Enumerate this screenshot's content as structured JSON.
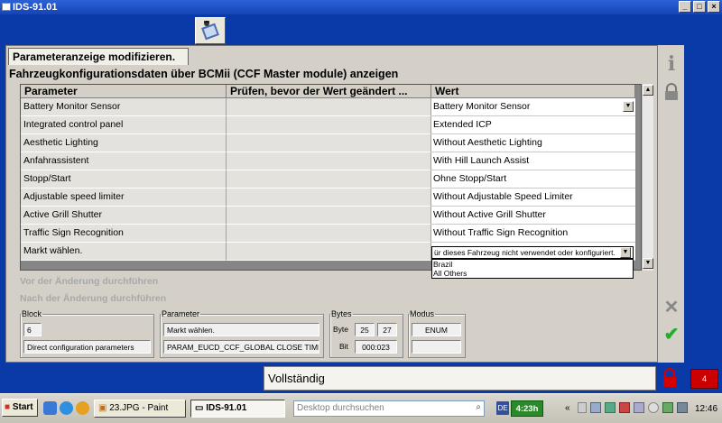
{
  "window": {
    "title": "IDS-91.01",
    "min_label": "_",
    "max_label": "□",
    "close_label": "×"
  },
  "tab_label": "Parameteranzeige modifizieren.",
  "subtitle": "Fahrzeugkonfigurationsdaten über BCMii (CCF Master module) anzeigen",
  "table": {
    "headers": [
      "Parameter",
      "Prüfen, bevor der Wert geändert ...",
      "Wert"
    ],
    "rows": [
      {
        "param": "Battery Monitor Sensor",
        "check": "",
        "value": "Battery Monitor Sensor"
      },
      {
        "param": "Integrated control panel",
        "check": "",
        "value": "Extended ICP"
      },
      {
        "param": "Aesthetic Lighting",
        "check": "",
        "value": "Without Aesthetic Lighting"
      },
      {
        "param": "Anfahrassistent",
        "check": "",
        "value": "With Hill Launch Assist"
      },
      {
        "param": "Stopp/Start",
        "check": "",
        "value": "Ohne Stopp/Start"
      },
      {
        "param": "Adjustable speed limiter",
        "check": "",
        "value": "Without Adjustable Speed Limiter"
      },
      {
        "param": "Active Grill Shutter",
        "check": "",
        "value": "Without Active Grill Shutter"
      },
      {
        "param": "Traffic Sign Recognition",
        "check": "",
        "value": "Without Traffic Sign Recognition"
      },
      {
        "param": "Markt wählen.",
        "check": "",
        "value": ""
      }
    ],
    "dropdown_selected": "ür dieses Fahrzeug nicht verwendet oder konfiguriert.",
    "dropdown_options": [
      "Brazil",
      "All Others"
    ]
  },
  "before_label": "Vor der Änderung durchführen",
  "after_label": "Nach der Änderung durchführen",
  "block": {
    "legend": "Block",
    "number": "6",
    "name": "Direct configuration parameters"
  },
  "parameter": {
    "legend": "Parameter",
    "name": "Markt wählen.",
    "code": "PARAM_EUCD_CCF_GLOBAL CLOSE TIME"
  },
  "bytes": {
    "legend": "Bytes",
    "byte_label": "Byte",
    "byte_from": "25",
    "byte_to": "27",
    "bit_label": "Bit",
    "bit_value": "000:023"
  },
  "modus": {
    "legend": "Modus",
    "value": "ENUM",
    "extra": ""
  },
  "status_text": "Vollständig",
  "red_box_label": "4",
  "taskbar": {
    "start_label": "Start",
    "buttons": [
      "23.JPG - Paint",
      "IDS-91.01"
    ],
    "search_placeholder": "Desktop durchsuchen",
    "timer": "4:23h",
    "clock": "12:46"
  },
  "icons": {
    "top": "vehicle-config-icon",
    "right_1": "info-icon",
    "right_2": "lock-icon",
    "right_3": "cancel-x-icon",
    "right_4": "checkmark-icon",
    "status_lock": "red-lock-icon"
  },
  "colors": {
    "desktop_blue": "#0a3aa8",
    "panel_grey": "#d4d0c8",
    "check_green": "#1fae2a",
    "alert_red": "#cc0000"
  }
}
